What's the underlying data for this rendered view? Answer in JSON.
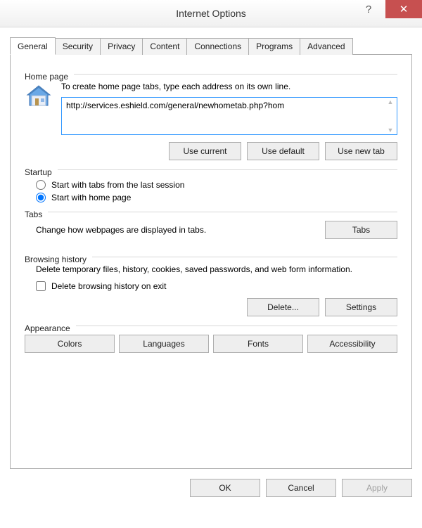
{
  "window": {
    "title": "Internet Options",
    "help_label": "?",
    "close_label": "✕"
  },
  "tabs": {
    "general": "General",
    "security": "Security",
    "privacy": "Privacy",
    "content": "Content",
    "connections": "Connections",
    "programs": "Programs",
    "advanced": "Advanced"
  },
  "homepage": {
    "label": "Home page",
    "description": "To create home page tabs, type each address on its own line.",
    "url_value": "http://services.eshield.com/general/newhometab.php?hom",
    "use_current": "Use current",
    "use_default": "Use default",
    "use_new_tab": "Use new tab"
  },
  "startup": {
    "label": "Startup",
    "option_last_session": "Start with tabs from the last session",
    "option_home_page": "Start with home page"
  },
  "tabs_section": {
    "label": "Tabs",
    "description": "Change how webpages are displayed in tabs.",
    "button": "Tabs"
  },
  "history": {
    "label": "Browsing history",
    "description": "Delete temporary files, history, cookies, saved passwords, and web form information.",
    "checkbox_label": "Delete browsing history on exit",
    "delete_button": "Delete...",
    "settings_button": "Settings"
  },
  "appearance": {
    "label": "Appearance",
    "colors": "Colors",
    "languages": "Languages",
    "fonts": "Fonts",
    "accessibility": "Accessibility"
  },
  "footer": {
    "ok": "OK",
    "cancel": "Cancel",
    "apply": "Apply"
  }
}
